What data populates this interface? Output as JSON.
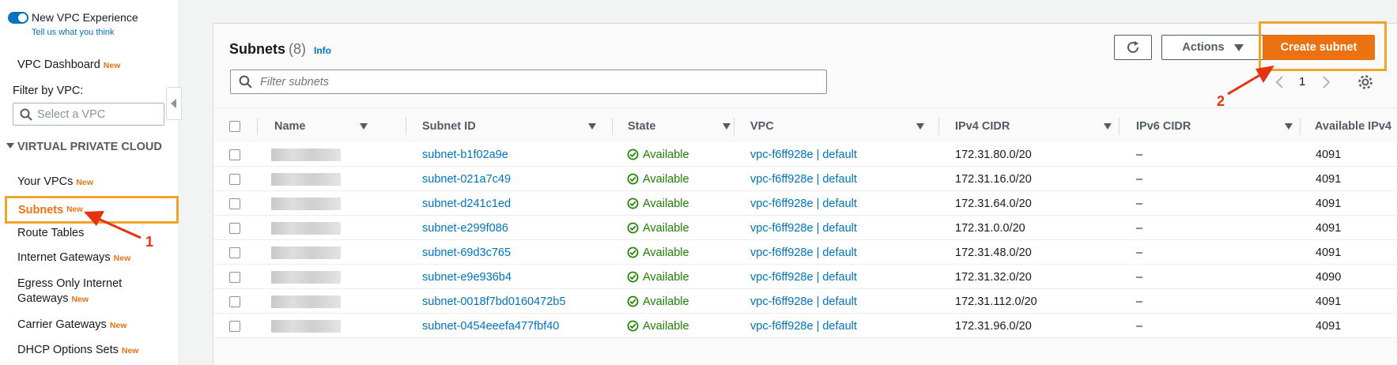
{
  "sidebar": {
    "toggle_label": "New VPC Experience",
    "tell_us": "Tell us what you think",
    "dashboard": "VPC Dashboard",
    "new_badge": "New",
    "filter_label": "Filter by VPC:",
    "vpc_select_placeholder": "Select a VPC",
    "section": "VIRTUAL PRIVATE CLOUD",
    "items": [
      {
        "label": "Your VPCs",
        "new": "New"
      },
      {
        "label": "Subnets",
        "new": "New"
      },
      {
        "label": "Route Tables",
        "new": ""
      },
      {
        "label": "Internet Gateways",
        "new": "New"
      },
      {
        "label": "Egress Only Internet",
        "label2": "Gateways",
        "new": "New"
      },
      {
        "label": "Carrier Gateways",
        "new": "New"
      },
      {
        "label": "DHCP Options Sets",
        "new": "New"
      }
    ]
  },
  "header": {
    "title": "Subnets",
    "count": "(8)",
    "info": "Info",
    "filter_placeholder": "Filter subnets",
    "actions_label": "Actions",
    "create_label": "Create subnet",
    "page": "1"
  },
  "table": {
    "columns": [
      "Name",
      "Subnet ID",
      "State",
      "VPC",
      "IPv4 CIDR",
      "IPv6 CIDR",
      "Available IPv4"
    ],
    "rows": [
      {
        "subnet_id": "subnet-b1f02a9e",
        "state": "Available",
        "vpc": "vpc-f6ff928e | default",
        "ipv4": "172.31.80.0/20",
        "ipv6": "–",
        "avail": "4091"
      },
      {
        "subnet_id": "subnet-021a7c49",
        "state": "Available",
        "vpc": "vpc-f6ff928e | default",
        "ipv4": "172.31.16.0/20",
        "ipv6": "–",
        "avail": "4091"
      },
      {
        "subnet_id": "subnet-d241c1ed",
        "state": "Available",
        "vpc": "vpc-f6ff928e | default",
        "ipv4": "172.31.64.0/20",
        "ipv6": "–",
        "avail": "4091"
      },
      {
        "subnet_id": "subnet-e299f086",
        "state": "Available",
        "vpc": "vpc-f6ff928e | default",
        "ipv4": "172.31.0.0/20",
        "ipv6": "–",
        "avail": "4091"
      },
      {
        "subnet_id": "subnet-69d3c765",
        "state": "Available",
        "vpc": "vpc-f6ff928e | default",
        "ipv4": "172.31.48.0/20",
        "ipv6": "–",
        "avail": "4091"
      },
      {
        "subnet_id": "subnet-e9e936b4",
        "state": "Available",
        "vpc": "vpc-f6ff928e | default",
        "ipv4": "172.31.32.0/20",
        "ipv6": "–",
        "avail": "4090"
      },
      {
        "subnet_id": "subnet-0018f7bd0160472b5",
        "state": "Available",
        "vpc": "vpc-f6ff928e | default",
        "ipv4": "172.31.112.0/20",
        "ipv6": "–",
        "avail": "4091"
      },
      {
        "subnet_id": "subnet-0454eeefa477fbf40",
        "state": "Available",
        "vpc": "vpc-f6ff928e | default",
        "ipv4": "172.31.96.0/20",
        "ipv6": "–",
        "avail": "4091"
      }
    ]
  },
  "annotations": {
    "step1": "1",
    "step2": "2"
  },
  "colors": {
    "accent": "#ec7211",
    "link": "#0073bb",
    "success": "#1d8102",
    "highlight": "#f0a52a",
    "annotation": "#e53212"
  },
  "icons": [
    "search-icon",
    "refresh-icon",
    "caret-down-icon",
    "chevron-left-icon",
    "chevron-right-icon",
    "gear-icon",
    "check-circle-icon",
    "collapse-icon"
  ]
}
